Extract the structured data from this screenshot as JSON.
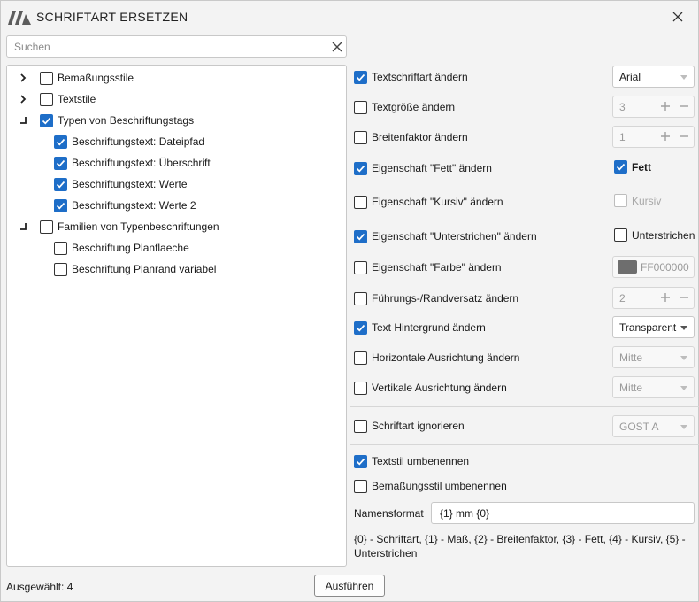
{
  "window": {
    "title": "SCHRIFTART ERSETZEN"
  },
  "search": {
    "placeholder": "Suchen",
    "value": ""
  },
  "tree": {
    "items": [
      {
        "label": "Bemaßungsstile",
        "checked": false,
        "expander": "collapsed"
      },
      {
        "label": "Textstile",
        "checked": false,
        "expander": "collapsed"
      },
      {
        "label": "Typen von Beschriftungstags",
        "checked": true,
        "expander": "expanded"
      },
      {
        "label": "Beschriftungstext: Dateipfad",
        "checked": true
      },
      {
        "label": "Beschriftungstext: Überschrift",
        "checked": true
      },
      {
        "label": "Beschriftungstext: Werte",
        "checked": true
      },
      {
        "label": "Beschriftungstext: Werte 2",
        "checked": true
      },
      {
        "label": "Familien von Typenbeschriftungen",
        "checked": false,
        "expander": "expanded"
      },
      {
        "label": "Beschriftung Planflaeche",
        "checked": false
      },
      {
        "label": "Beschriftung Planrand variabel",
        "checked": false
      }
    ]
  },
  "options": {
    "font_family": {
      "label": "Textschriftart ändern",
      "checked": true,
      "value": "Arial"
    },
    "font_size": {
      "label": "Textgröße ändern",
      "checked": false,
      "value": "3"
    },
    "width_factor": {
      "label": "Breitenfaktor ändern",
      "checked": false,
      "value": "1"
    },
    "bold": {
      "label": "Eigenschaft \"Fett\" ändern",
      "checked": true,
      "toggle_label": "Fett",
      "toggle_checked": true
    },
    "italic": {
      "label": "Eigenschaft \"Kursiv\" ändern",
      "checked": false,
      "toggle_label": "Kursiv",
      "toggle_checked": false
    },
    "underline": {
      "label": "Eigenschaft \"Unterstrichen\" ändern",
      "checked": true,
      "toggle_label": "Unterstrichen",
      "toggle_checked": false
    },
    "color": {
      "label": "Eigenschaft \"Farbe\" ändern",
      "checked": false,
      "value": "FF000000",
      "swatch": "#6e6e6e"
    },
    "leader_offset": {
      "label": "Führungs-/Randversatz ändern",
      "checked": false,
      "value": "2"
    },
    "text_background": {
      "label": "Text Hintergrund ändern",
      "checked": true,
      "value": "Transparent"
    },
    "horizontal_align": {
      "label": "Horizontale Ausrichtung ändern",
      "checked": false,
      "value": "Mitte"
    },
    "vertical_align": {
      "label": "Vertikale Ausrichtung ändern",
      "checked": false,
      "value": "Mitte"
    },
    "ignore_font": {
      "label": "Schriftart ignorieren",
      "checked": false,
      "value": "GOST A"
    },
    "rename_text_style": {
      "label": "Textstil umbenennen",
      "checked": true
    },
    "rename_dim_style": {
      "label": "Bemaßungsstil umbenennen",
      "checked": false
    },
    "name_format": {
      "label": "Namensformat",
      "value": "{1} mm {0}"
    },
    "help_text": "{0} - Schriftart, {1} - Maß, {2} - Breitenfaktor, {3} - Fett, {4} - Kursiv, {5} - Unterstrichen"
  },
  "footer": {
    "status": "Ausgewählt: 4",
    "run_label": "Ausführen"
  },
  "colors": {
    "accent": "#1e6ec8",
    "window_bg": "#f3f3f3",
    "panel_bg": "#ffffff",
    "border": "#c8c8c8"
  }
}
